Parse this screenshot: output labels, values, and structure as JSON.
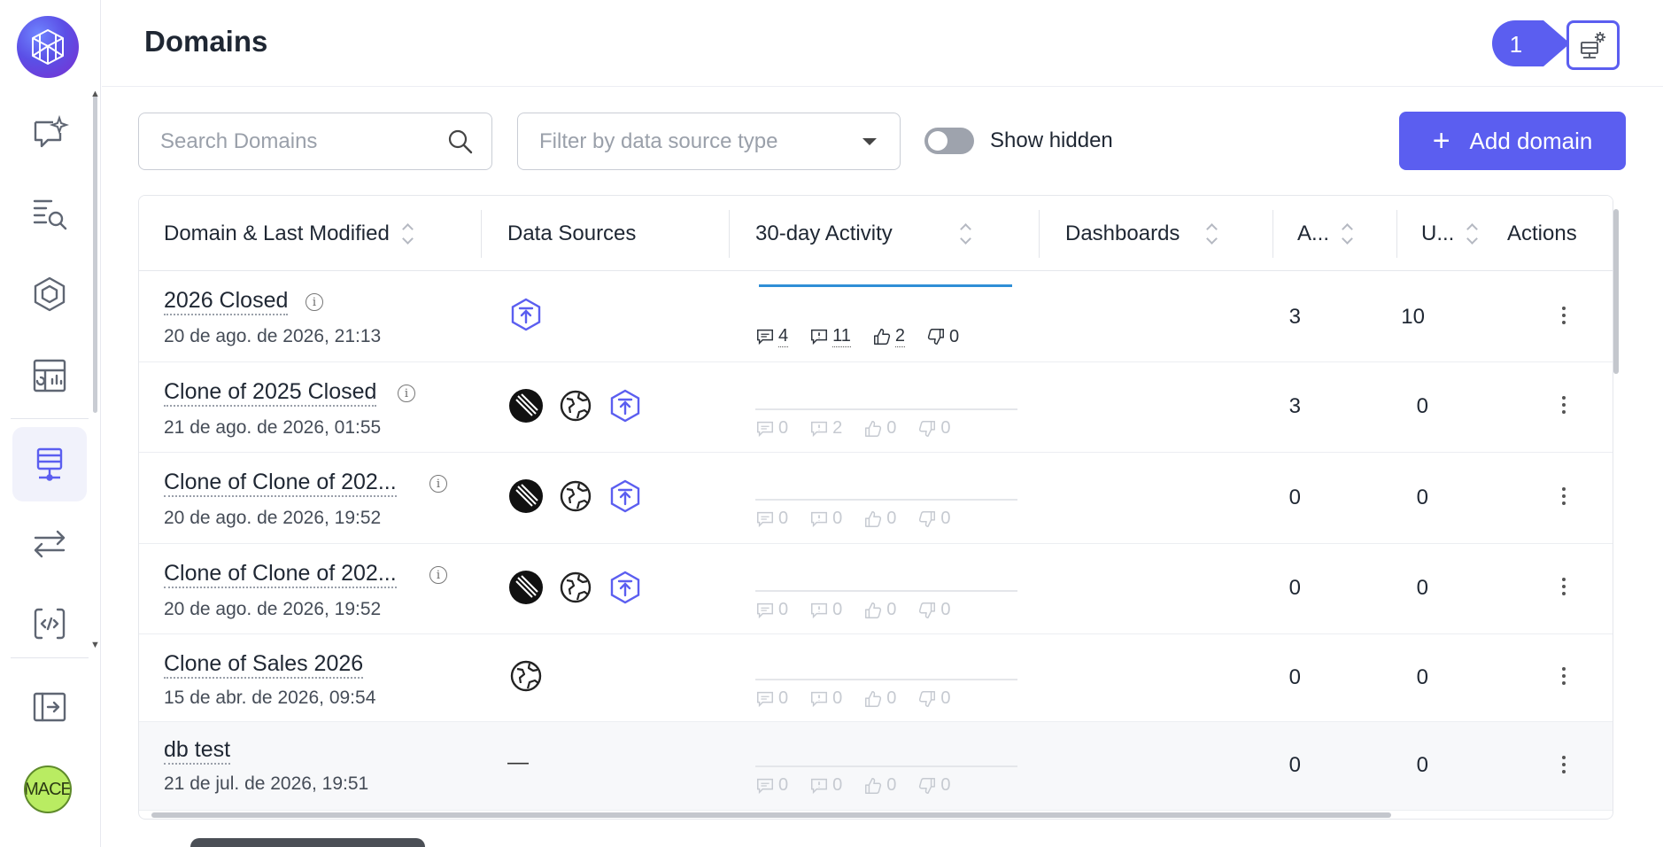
{
  "header": {
    "title": "Domains",
    "step_number": "1"
  },
  "toolbar": {
    "search_placeholder": "Search Domains",
    "filter_placeholder": "Filter by data source type",
    "show_hidden_label": "Show hidden",
    "add_domain_label": "Add domain"
  },
  "sidebar": {
    "avatar_text": "MACE"
  },
  "table": {
    "columns": [
      "Domain & Last Modified",
      "Data Sources",
      "30-day Activity",
      "Dashboards",
      "A...",
      "U...",
      "Actions"
    ],
    "rows": [
      {
        "name": "2026 Closed",
        "date": "20 de ago. de 2026, 21:13",
        "comments": "4",
        "flags": "11",
        "likes": "2",
        "dislikes": "0",
        "dashboards": "3",
        "a": "10",
        "dash_placeholder": ""
      },
      {
        "name": "Clone of 2025 Closed",
        "date": "21 de ago. de 2026, 01:55",
        "comments": "0",
        "flags": "2",
        "likes": "0",
        "dislikes": "0",
        "dashboards": "3",
        "a": "0",
        "dash_placeholder": ""
      },
      {
        "name": "Clone of Clone of 202...",
        "date": "20 de ago. de 2026, 19:52",
        "comments": "0",
        "flags": "0",
        "likes": "0",
        "dislikes": "0",
        "dashboards": "0",
        "a": "0",
        "dash_placeholder": ""
      },
      {
        "name": "Clone of Clone of 202...",
        "date": "20 de ago. de 2026, 19:52",
        "comments": "0",
        "flags": "0",
        "likes": "0",
        "dislikes": "0",
        "dashboards": "0",
        "a": "0",
        "dash_placeholder": ""
      },
      {
        "name": "Clone of Sales 2026",
        "date": "15 de abr. de 2026, 09:54",
        "comments": "0",
        "flags": "0",
        "likes": "0",
        "dislikes": "0",
        "dashboards": "0",
        "a": "0",
        "dash_placeholder": ""
      },
      {
        "name": "db test",
        "date": "21 de jul. de 2026, 19:51",
        "comments": "0",
        "flags": "0",
        "likes": "0",
        "dislikes": "0",
        "dashboards": "0",
        "a": "0",
        "dash_placeholder": "—"
      }
    ]
  },
  "colors": {
    "accent": "#5b5ef0",
    "sparkline": "#2f8fd6"
  }
}
